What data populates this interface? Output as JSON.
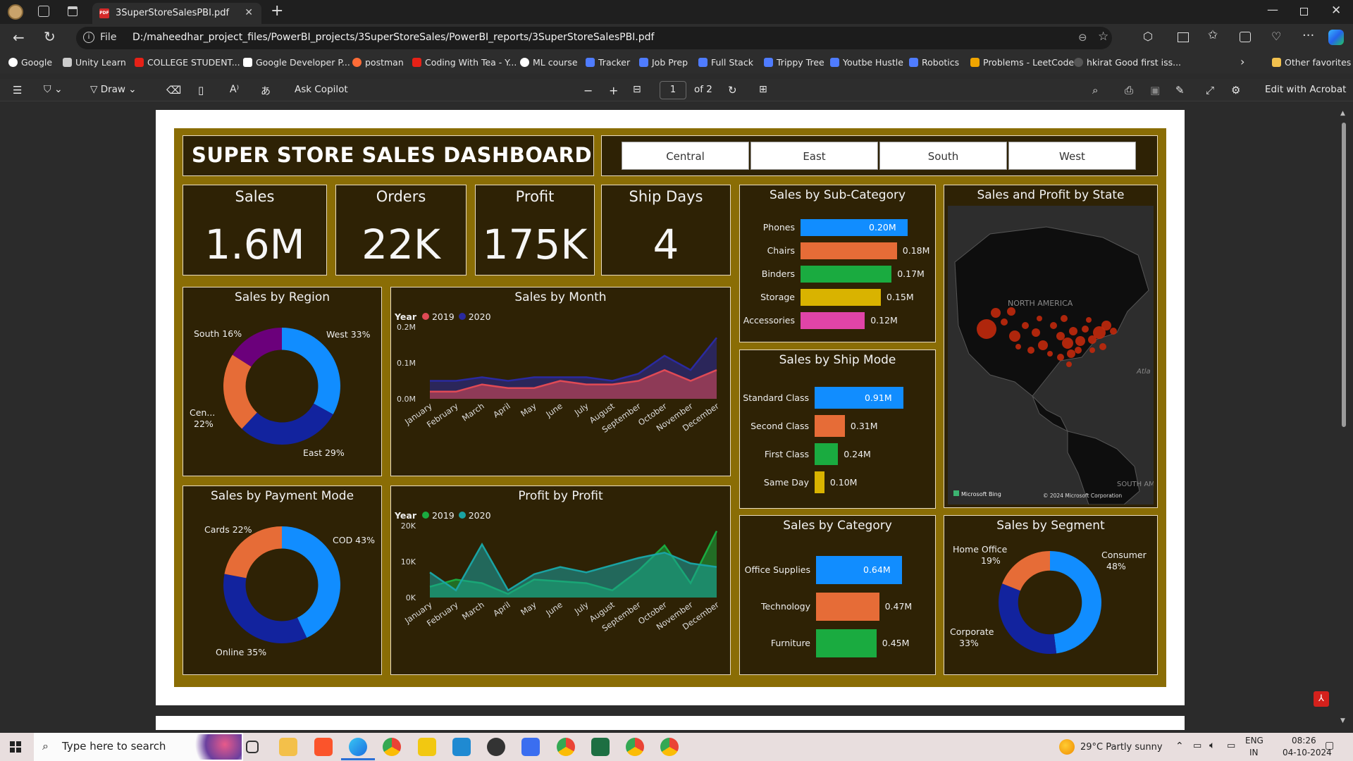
{
  "browser": {
    "tab_title": "3SuperStoreSalesPBI.pdf",
    "address_prefix": "File",
    "url": "D:/maheedhar_project_files/PowerBI_projects/3SuperStoreSales/PowerBI_reports/3SuperStoreSalesPBI.pdf",
    "bookmarks": [
      "Google",
      "Unity Learn",
      "COLLEGE STUDENT...",
      "Google Developer P...",
      "postman",
      "Coding With Tea - Y...",
      "ML course",
      "Tracker",
      "Job Prep",
      "Full Stack",
      "Trippy Tree",
      "Youtbe Hustle",
      "Robotics",
      "Problems - LeetCode",
      "hkirat Good first iss..."
    ],
    "other_favorites": "Other favorites"
  },
  "pdf_toolbar": {
    "draw": "Draw",
    "ask_copilot": "Ask Copilot",
    "page_current": "1",
    "page_total": "of 2",
    "edit_acrobat": "Edit with Acrobat"
  },
  "dashboard": {
    "title": "SUPER STORE SALES DASHBOARD",
    "regions": [
      "Central",
      "East",
      "South",
      "West"
    ],
    "kpis": [
      {
        "label": "Sales",
        "value": "1.6M"
      },
      {
        "label": "Orders",
        "value": "22K"
      },
      {
        "label": "Profit",
        "value": "175K"
      },
      {
        "label": "Ship Days",
        "value": "4"
      }
    ],
    "map": {
      "title": "Sales and Profit by State",
      "label_na": "NORTH AMERICA",
      "label_atl": "Atla",
      "label_sa": "SOUTH AM",
      "bing": "Microsoft Bing",
      "copyright": "© 2024 Microsoft Corporation"
    }
  },
  "chart_data": [
    {
      "title": "Sales by Region",
      "type": "pie",
      "donut": true,
      "categories": [
        "West",
        "East",
        "Central",
        "South"
      ],
      "values": [
        33,
        29,
        22,
        16
      ],
      "labels": [
        "West 33%",
        "East 29%",
        "Cen...",
        "22%",
        "South 16%"
      ],
      "colors": [
        "#118dff",
        "#12239e",
        "#e66c37",
        "#6b007b"
      ]
    },
    {
      "title": "Sales by Month",
      "type": "area",
      "legend_title": "Year",
      "legend_position": "top-left",
      "categories": [
        "January",
        "February",
        "March",
        "April",
        "May",
        "June",
        "July",
        "August",
        "September",
        "October",
        "November",
        "December"
      ],
      "series": [
        {
          "name": "2019",
          "color": "#e04a55",
          "values": [
            0.02,
            0.02,
            0.04,
            0.03,
            0.03,
            0.05,
            0.04,
            0.04,
            0.05,
            0.08,
            0.05,
            0.08
          ]
        },
        {
          "name": "2020",
          "color": "#2a2aa0",
          "values": [
            0.05,
            0.05,
            0.06,
            0.05,
            0.06,
            0.06,
            0.06,
            0.05,
            0.07,
            0.12,
            0.08,
            0.17
          ]
        }
      ],
      "yticks": [
        "0.0M",
        "0.1M",
        "0.2M"
      ],
      "ylim": [
        0,
        0.2
      ]
    },
    {
      "title": "Sales by Sub-Category",
      "type": "bar",
      "orientation": "horizontal",
      "categories": [
        "Phones",
        "Chairs",
        "Binders",
        "Storage",
        "Accessories"
      ],
      "values": [
        0.2,
        0.18,
        0.17,
        0.15,
        0.12
      ],
      "labels": [
        "0.20M",
        "0.18M",
        "0.17M",
        "0.15M",
        "0.12M"
      ],
      "colors": [
        "#118dff",
        "#e66c37",
        "#1aab40",
        "#d9b300",
        "#e044a7"
      ]
    },
    {
      "title": "Sales by Ship Mode",
      "type": "bar",
      "orientation": "horizontal",
      "categories": [
        "Standard Class",
        "Second Class",
        "First Class",
        "Same Day"
      ],
      "values": [
        0.91,
        0.31,
        0.24,
        0.1
      ],
      "labels": [
        "0.91M",
        "0.31M",
        "0.24M",
        "0.10M"
      ],
      "colors": [
        "#118dff",
        "#e66c37",
        "#1aab40",
        "#d9b300"
      ]
    },
    {
      "title": "Sales by Payment Mode",
      "type": "pie",
      "donut": true,
      "categories": [
        "COD",
        "Online",
        "Cards"
      ],
      "values": [
        43,
        35,
        22
      ],
      "labels": [
        "COD 43%",
        "Online 35%",
        "Cards 22%"
      ],
      "colors": [
        "#118dff",
        "#12239e",
        "#e66c37"
      ]
    },
    {
      "title": "Profit by Profit",
      "type": "area",
      "legend_title": "Year",
      "legend_position": "top-left",
      "categories": [
        "January",
        "February",
        "March",
        "April",
        "May",
        "June",
        "July",
        "August",
        "September",
        "October",
        "November",
        "December"
      ],
      "series": [
        {
          "name": "2019",
          "color": "#1aab40",
          "values": [
            3000,
            5000,
            4000,
            1000,
            5000,
            4500,
            4000,
            2000,
            7500,
            14500,
            4000,
            18500
          ]
        },
        {
          "name": "2020",
          "color": "#1aa3a3",
          "values": [
            7000,
            2000,
            14800,
            2000,
            6500,
            8500,
            7000,
            9000,
            11000,
            12500,
            9500,
            8500
          ]
        }
      ],
      "yticks": [
        "0K",
        "10K",
        "20K"
      ],
      "ylim": [
        0,
        20000
      ]
    },
    {
      "title": "Sales by Category",
      "type": "bar",
      "orientation": "horizontal",
      "categories": [
        "Office Supplies",
        "Technology",
        "Furniture"
      ],
      "values": [
        0.64,
        0.47,
        0.45
      ],
      "labels": [
        "0.64M",
        "0.47M",
        "0.45M"
      ],
      "colors": [
        "#118dff",
        "#e66c37",
        "#1aab40"
      ]
    },
    {
      "title": "Sales by Segment",
      "type": "pie",
      "donut": true,
      "categories": [
        "Consumer",
        "Corporate",
        "Home Office"
      ],
      "values": [
        48,
        33,
        19
      ],
      "labels": [
        "Consumer",
        "48%",
        "Corporate",
        "33%",
        "Home Office",
        "19%"
      ],
      "colors": [
        "#118dff",
        "#12239e",
        "#e66c37"
      ]
    }
  ],
  "taskbar": {
    "search_placeholder": "Type here to search",
    "weather": "29°C  Partly sunny",
    "lang1": "ENG",
    "lang2": "IN",
    "time": "08:26",
    "date": "04-10-2024"
  }
}
